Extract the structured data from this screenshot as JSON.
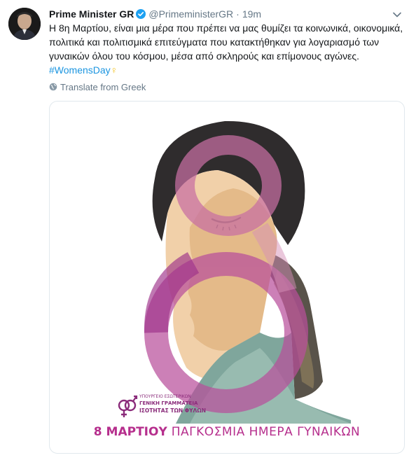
{
  "tweet": {
    "author_name": "Prime Minister GR",
    "author_handle": "@PrimeministerGR",
    "separator": "·",
    "time": "19m",
    "text_main": "Η 8η Μαρτίου, είναι μια μέρα που πρέπει να μας θυμίζει τα κοινωνικά, οικονομικά, πολιτικά και πολιτισμικά επιτεύγματα που κατακτήθηκαν για λογαριασμό των γυναικών όλου του κόσμου, μέσα από σκληρούς και επίμονους αγώνες. ",
    "hashtag": "#WomensDay",
    "emoji": "♀",
    "translate_label": "Translate from Greek"
  },
  "poster": {
    "ministry_line1": "ΥΠΟΥΡΓΕΙΟ ΕΣΩΤΕΡΙΚΩΝ",
    "ministry_line2": "ΓΕΝΙΚΗ ΓΡΑΜΜΑΤΕΙΑ",
    "ministry_line3": "ΙΣΟΤΗΤΑΣ ΤΩΝ ΦΥΛΩΝ",
    "caption_bold": "8 ΜΑΡΤΙΟΥ",
    "caption_rest": "ΠΑΓΚΟΣΜΙΑ ΗΜΕΡΑ ΓΥΝΑΙΚΩΝ"
  },
  "icons": {
    "verified": "verified-badge-icon",
    "caret": "chevron-down-icon",
    "globe": "globe-icon",
    "ministry_logo": "gender-symbols-icon"
  },
  "colors": {
    "link": "#1b95e0",
    "muted": "#657786",
    "poster_magenta": "#b62f8d"
  }
}
